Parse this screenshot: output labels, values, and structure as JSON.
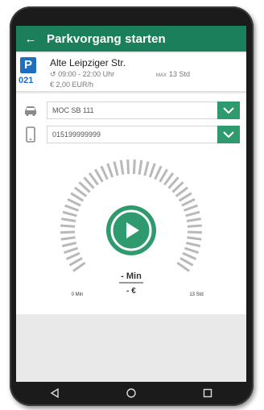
{
  "app_bar": {
    "title": "Parkvorgang starten",
    "back_icon": "arrow-back-icon"
  },
  "zone": {
    "badge": "P",
    "number": "021",
    "street": "Alte Leipziger Str.",
    "hours": "09:00 - 22:00 Uhr",
    "max_prefix": "MAX",
    "max_duration": "13 Std",
    "price": "2,00 EUR/h"
  },
  "vehicle": {
    "value": "MOC SB 111",
    "icon": "car-icon"
  },
  "phone": {
    "value": "015199999999",
    "icon": "smartphone-icon"
  },
  "dial": {
    "duration": "- Min",
    "cost": "- €",
    "min_label": "0 Min",
    "max_label": "13 Std"
  },
  "colors": {
    "primary": "#1a7f5a",
    "accent": "#2e9a6e",
    "badge": "#1e6fc2",
    "tick": "#b9b9b9"
  },
  "navigation": {
    "back": "nav-back-icon",
    "home": "nav-home-icon",
    "recents": "nav-recents-icon"
  }
}
